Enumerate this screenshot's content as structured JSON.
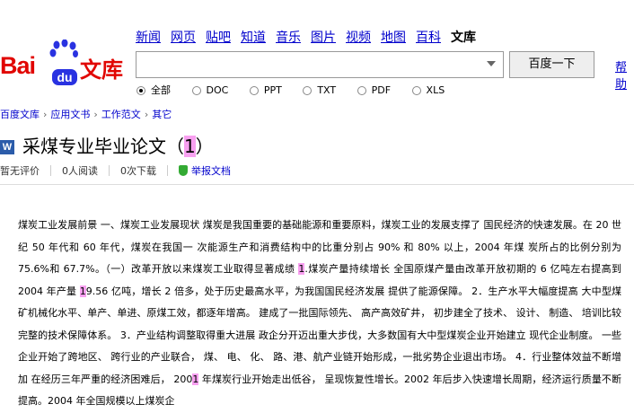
{
  "logo": {
    "bai": "Bai",
    "du": "du",
    "wenku": "文库"
  },
  "nav": {
    "items": [
      "新闻",
      "网页",
      "贴吧",
      "知道",
      "音乐",
      "图片",
      "视频",
      "地图",
      "百科"
    ],
    "current": "文库"
  },
  "search": {
    "button": "百度一下",
    "help": "帮助",
    "value": ""
  },
  "filters": [
    "全部",
    "DOC",
    "PPT",
    "TXT",
    "PDF",
    "XLS"
  ],
  "breadcrumb": [
    "百度文库",
    "应用文书",
    "工作范文",
    "其它"
  ],
  "doc": {
    "title_main": "采煤专业毕业论文（",
    "title_hl": "1",
    "title_end": "）",
    "rating": "暂无评价",
    "reads": "0人阅读",
    "downloads": "0次下载",
    "report": "举报文档"
  },
  "body": {
    "p1": "煤炭工业发展前景 一、煤炭工业发展现状 煤炭是我国重要的基础能源和重要原料，煤炭工业的发展支撑了 国民经济的快速发展。在 20 世纪 50 年代和 60 年代，煤炭在我国一 次能源生产和消费结构中的比重分别占 90% 和 80% 以上，2004 年煤 炭所占的比例分别为 75.6%和 67.7%。（一）改革开放以来煤炭工业取得显著成绩 ",
    "h1": "1",
    "p2": ".煤炭产量持续增长 全国原煤产量由改革开放初期的 6 亿吨左右提高到 2004 年产量 ",
    "h2": "1",
    "p3": "9.56 亿吨，增长 2 倍多，处于历史最高水平，为我国国民经济发展 提供了能源保障。 2．生产水平大幅度提高 大中型煤矿机械化水平、单产、单进、原煤工效，都逐年增高。 建成了一批国际领先、 高产高效矿井， 初步建全了技术、 设计、 制造、 培训比较完整的技术保障体系。 3．产业结构调整取得重大进展 政企分开迈出重大步伐，大多数国有大中型煤炭企业开始建立 现代企业制度。 一些企业开始了跨地区、 跨行业的产业联合， 煤、 电、 化、 路、港、航产业链开始形成，一批劣势企业退出市场。 4．行业整体效益不断增加 在经历三年严重的经济困难后， 200",
    "h3": "1",
    "p4": " 年煤炭行业开始走出低谷， 呈现恢复性增长。2002 年后步入快速增长周期，经济运行质量不断 提高。2004 年全国规模以上煤炭企"
  }
}
